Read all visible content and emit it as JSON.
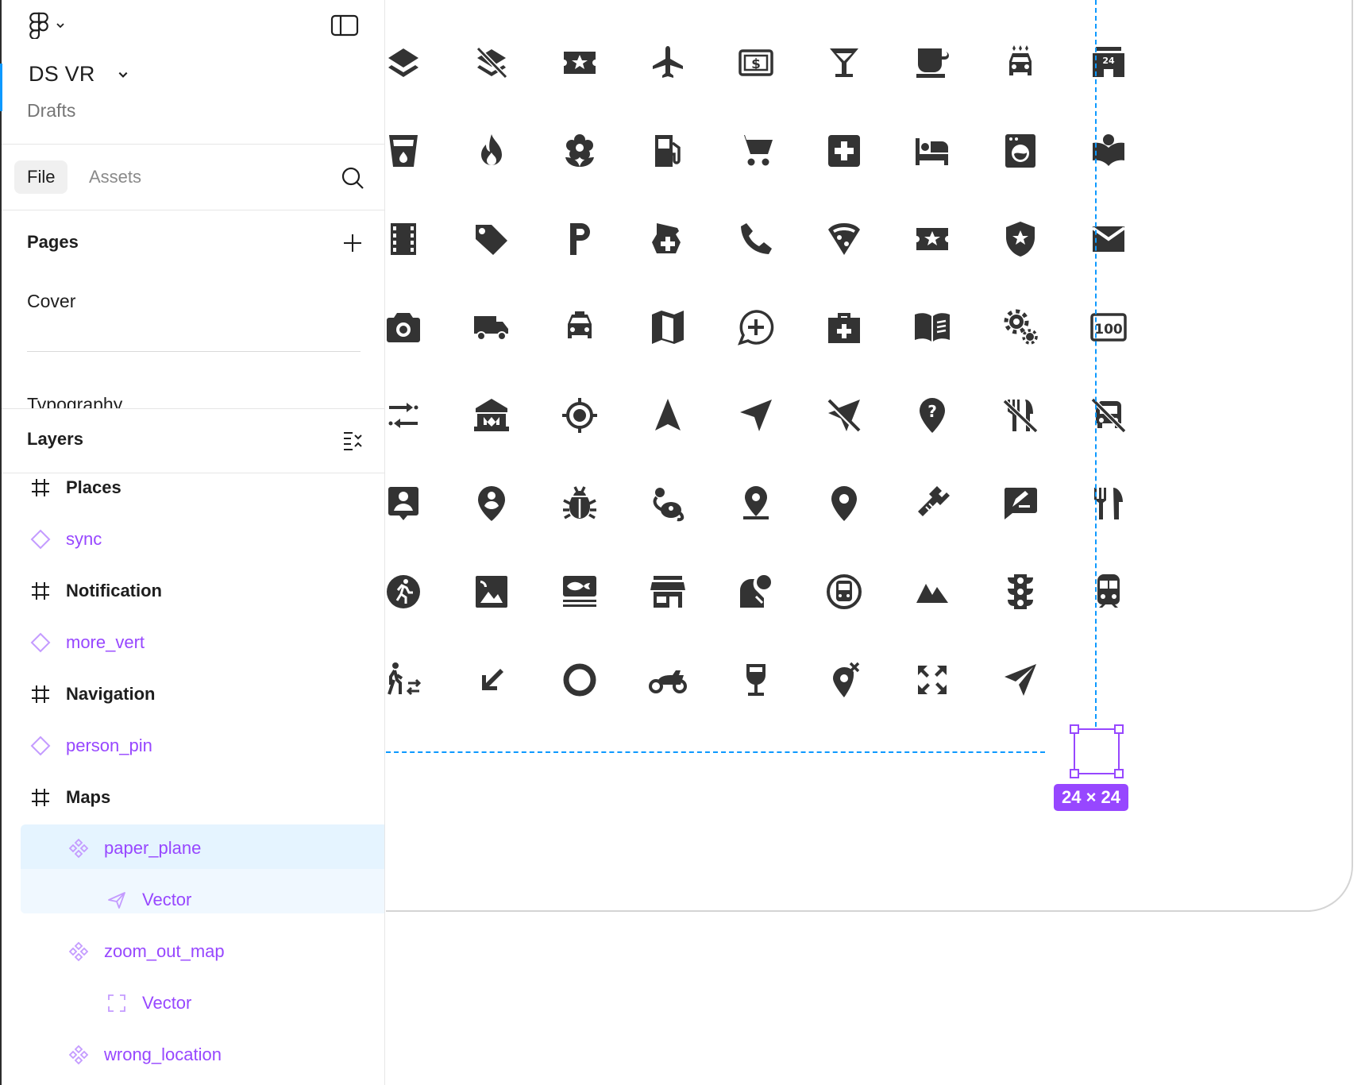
{
  "app": {
    "file_name": "DS VR",
    "file_location": "Drafts",
    "icons": {
      "main_menu": "figma-logo-icon",
      "panel_toggle": "sidebar-toggle-icon"
    }
  },
  "tabs": [
    {
      "label": "File",
      "active": true
    },
    {
      "label": "Assets",
      "active": false
    }
  ],
  "pages": {
    "title": "Pages",
    "items": [
      "Cover",
      "Typography"
    ]
  },
  "layers": {
    "title": "Layers",
    "items": [
      {
        "type": "frame",
        "name": "Places"
      },
      {
        "type": "component",
        "name": "sync"
      },
      {
        "type": "frame",
        "name": "Notification"
      },
      {
        "type": "component",
        "name": "more_vert"
      },
      {
        "type": "frame",
        "name": "Navigation"
      },
      {
        "type": "component",
        "name": "person_pin"
      },
      {
        "type": "frame",
        "name": "Maps"
      },
      {
        "type": "component-set",
        "name": "paper_plane",
        "selected": true
      },
      {
        "type": "vector",
        "name": "Vector",
        "selected": true
      },
      {
        "type": "component-set",
        "name": "zoom_out_map"
      },
      {
        "type": "vector",
        "name": "Vector"
      },
      {
        "type": "component-set",
        "name": "wrong_location"
      }
    ]
  },
  "canvas": {
    "selection_size": "24 × 24",
    "colors": {
      "selection": "#9747ff",
      "guide": "#0d99ff",
      "icon": "#333333"
    },
    "icon_rows": [
      [
        "layers-icon",
        "layers-clear-icon",
        "local-activity-icon",
        "airplane-icon",
        "local-atm-icon",
        "local-bar-icon",
        "local-cafe-icon",
        "car-wash-icon",
        "24-hour-store-icon"
      ],
      [
        "local-drink-icon",
        "local-fire-department-icon",
        "local-florist-icon",
        "local-gas-station-icon",
        "local-grocery-store-icon",
        "local-hospital-icon",
        "local-hotel-icon",
        "local-laundry-service-icon",
        "local-library-icon"
      ],
      [
        "local-movies-icon",
        "local-offer-icon",
        "local-parking-icon",
        "local-pharmacy-icon",
        "local-phone-icon",
        "local-pizza-icon",
        "local-play-icon",
        "local-police-icon",
        "local-post-office-icon"
      ],
      [
        "local-see-icon",
        "local-shipping-icon",
        "local-taxi-icon",
        "map-icon",
        "add-comment-icon",
        "medical-services-icon",
        "menu-book-icon",
        "settings-suggest-icon",
        "odometer-icon"
      ],
      [
        "multiple-stop-icon",
        "museum-icon",
        "my-location-icon",
        "navigation-icon",
        "near-me-icon",
        "near-me-disabled-icon",
        "not-listed-location-icon",
        "no-meals-icon",
        "no-transfer-icon"
      ],
      [
        "person-pin-icon",
        "person-pin-circle-icon",
        "pest-control-icon",
        "pest-control-rodent-icon",
        "pin-drop-icon",
        "place-icon",
        "plumbing-icon",
        "rate-review-icon",
        "restaurant-icon"
      ],
      [
        "run-circle-icon",
        "satellite-icon",
        "set-meal-icon",
        "store-mall-directory-icon",
        "streetview-icon",
        "subway-icon",
        "terrain-icon",
        "traffic-icon",
        "train-icon"
      ],
      [
        "transfer-within-station-icon",
        "south-west-arrow-icon",
        "trip-origin-icon",
        "two-wheeler-icon",
        "wine-bar-icon",
        "wrong-location-icon",
        "zoom-out-map-icon",
        "paper-plane-icon"
      ]
    ]
  }
}
